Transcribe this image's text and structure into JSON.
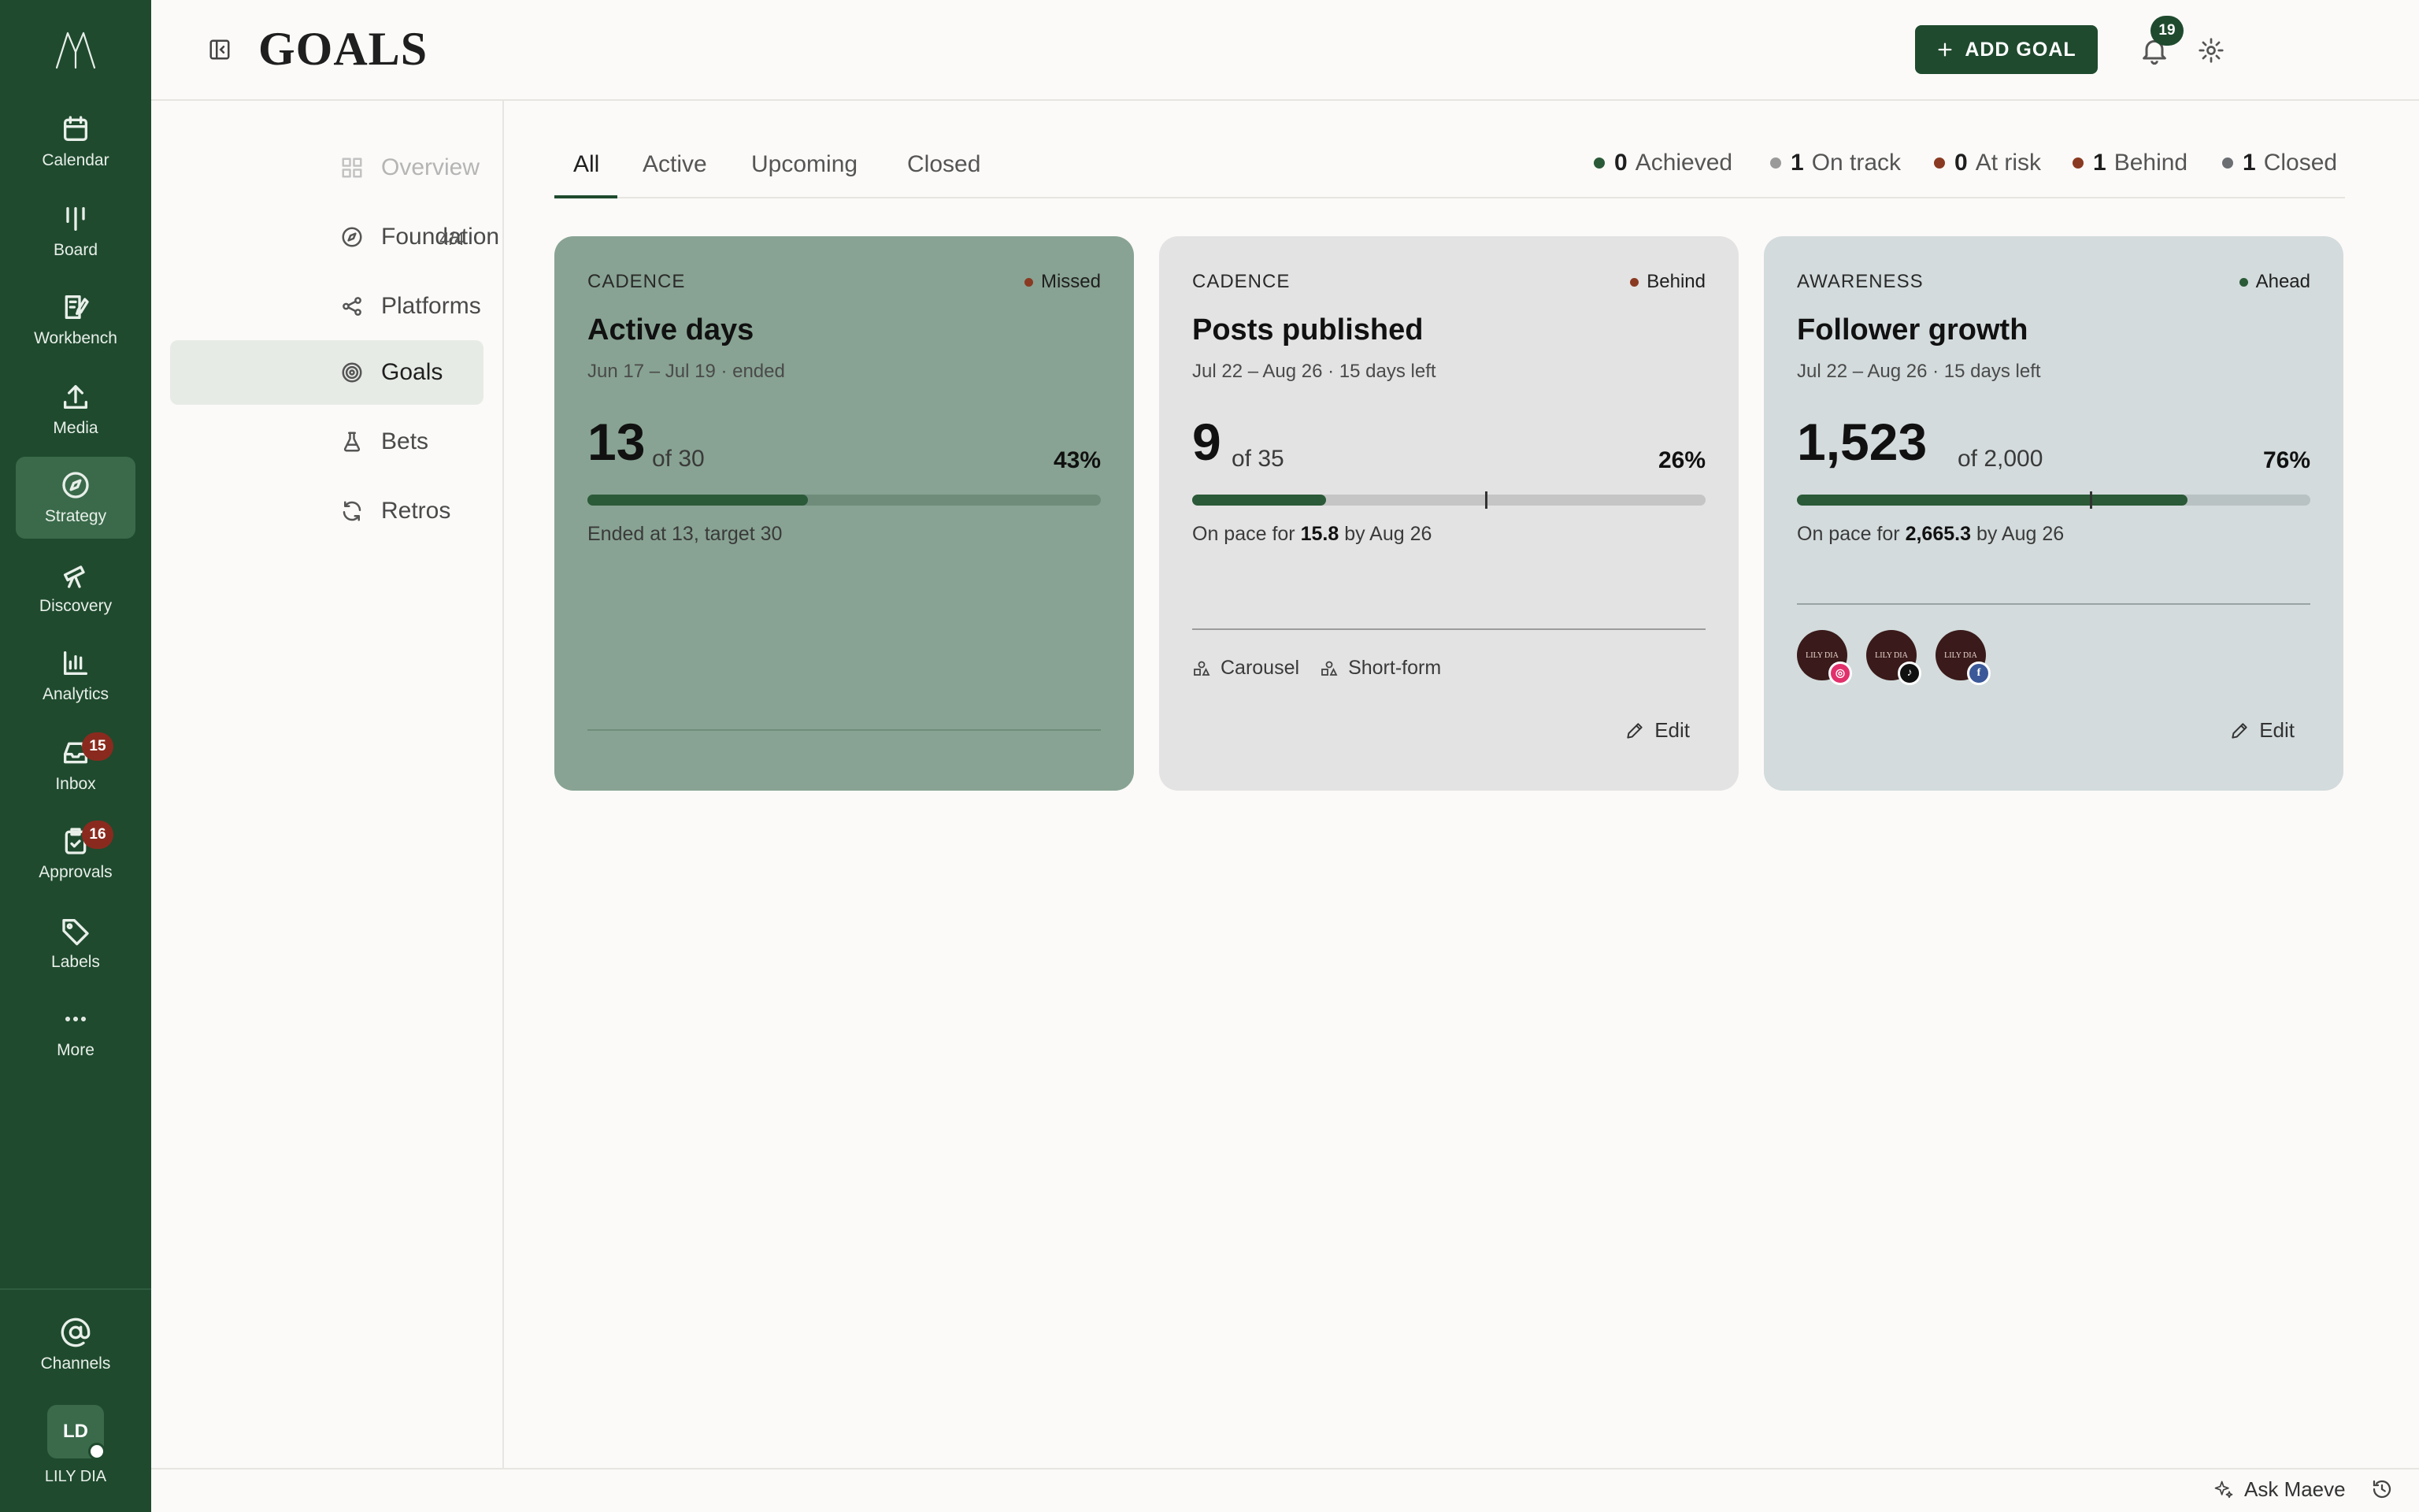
{
  "rail": {
    "items": [
      {
        "label": "Calendar",
        "icon": "calendar-icon"
      },
      {
        "label": "Board",
        "icon": "board-icon"
      },
      {
        "label": "Workbench",
        "icon": "workbench-icon"
      },
      {
        "label": "Media",
        "icon": "upload-icon"
      },
      {
        "label": "Strategy",
        "icon": "compass-icon",
        "active": true
      },
      {
        "label": "Discovery",
        "icon": "telescope-icon"
      },
      {
        "label": "Analytics",
        "icon": "bar-chart-icon"
      },
      {
        "label": "Inbox",
        "icon": "inbox-icon",
        "badge": "15"
      },
      {
        "label": "Approvals",
        "icon": "clipboard-check-icon",
        "badge": "16"
      },
      {
        "label": "Labels",
        "icon": "tag-icon"
      },
      {
        "label": "More",
        "icon": "more-icon"
      }
    ],
    "channels": "Channels",
    "user_initials": "LD",
    "user_name": "LILY DIA"
  },
  "header": {
    "title": "GOALS",
    "add_goal": "ADD GOAL",
    "notif_count": "19"
  },
  "subnav": {
    "items": [
      {
        "label": "Overview",
        "icon": "grid-icon",
        "dim": true
      },
      {
        "label": "Foundation",
        "icon": "compass-icon",
        "count": "4/4"
      },
      {
        "label": "Platforms",
        "icon": "share-icon"
      },
      {
        "label": "Goals",
        "icon": "target-icon",
        "active": true
      },
      {
        "label": "Bets",
        "icon": "flask-icon"
      },
      {
        "label": "Retros",
        "icon": "refresh-icon"
      }
    ]
  },
  "tabs": [
    "All",
    "Active",
    "Upcoming",
    "Closed"
  ],
  "summary": [
    {
      "count": "0",
      "label": "Achieved",
      "color": "#2b5a38"
    },
    {
      "count": "1",
      "label": "On track",
      "color": "#9a9a9a"
    },
    {
      "count": "0",
      "label": "At risk",
      "color": "#8a3a22"
    },
    {
      "count": "1",
      "label": "Behind",
      "color": "#8a3a22"
    },
    {
      "count": "1",
      "label": "Closed",
      "color": "#6b6e72"
    }
  ],
  "cards": [
    {
      "category": "CADENCE",
      "status": "Missed",
      "status_color": "#8a3a22",
      "title": "Active days",
      "dates": "Jun 17 – Jul 19 · ended",
      "value": "13",
      "target": "of 30",
      "percent": "43%",
      "progress": 0.43,
      "note": "Ended at 13, target 30"
    },
    {
      "category": "CADENCE",
      "status": "Behind",
      "status_color": "#8a3a22",
      "title": "Posts published",
      "dates": "Jul 22 – Aug 26 · 15 days left",
      "value": "9",
      "target": "of 35",
      "percent": "26%",
      "progress": 0.26,
      "pace_marker": 0.57,
      "note_prefix": "On pace for ",
      "note_value": "15.8",
      "note_suffix": " by Aug 26",
      "formats": [
        "Carousel",
        "Short-form"
      ],
      "edit": "Edit"
    },
    {
      "category": "AWARENESS",
      "status": "Ahead",
      "status_color": "#2b5a38",
      "title": "Follower growth",
      "dates": "Jul 22 – Aug 26 · 15 days left",
      "value": "1,523",
      "target": "of 2,000",
      "percent": "76%",
      "progress": 0.76,
      "pace_marker": 0.57,
      "note_prefix": "On pace for ",
      "note_value": "2,665.3",
      "note_suffix": " by Aug 26",
      "channels": [
        {
          "platform": "instagram",
          "color": "#e1306c"
        },
        {
          "platform": "tiktok",
          "color": "#111111"
        },
        {
          "platform": "facebook",
          "color": "#3b5998"
        }
      ],
      "edit": "Edit"
    }
  ],
  "footer": {
    "ask": "Ask Maeve"
  }
}
